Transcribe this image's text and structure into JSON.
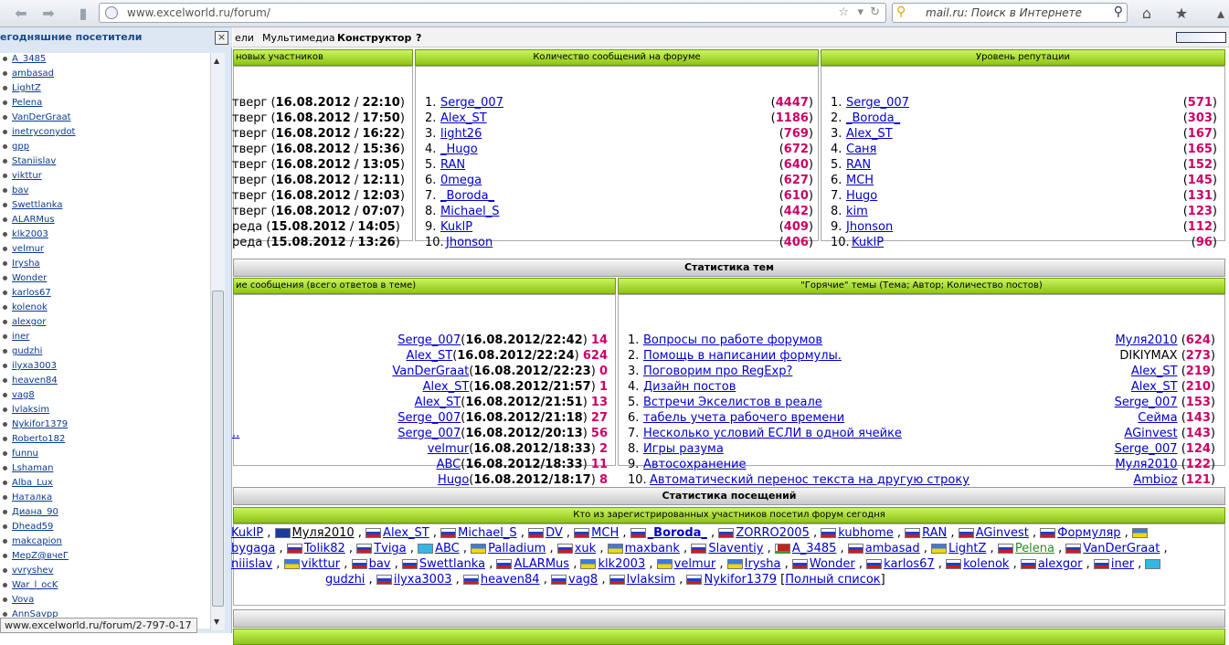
{
  "browser": {
    "url": "www.excelworld.ru/forum/",
    "search_placeholder": "mail.ru: Поиск в Интернете",
    "status": "www.excelworld.ru/forum/2-797-0-17"
  },
  "sidebar": {
    "title": "егодняшние посетители",
    "close": "×",
    "items": [
      "A_3485",
      "ambasad",
      "LightZ",
      "Pelena",
      "VanDerGraat",
      "inetryconydot",
      "gpp",
      "Staniislav",
      "vikttur",
      "bav",
      "Swettlanka",
      "ALARMus",
      "klk2003",
      "velmur",
      "Irysha",
      "Wonder",
      "karlos67",
      "kolenok",
      "alexgor",
      "iner",
      "gudzhi",
      "ilyxa3003",
      "heaven84",
      "vag8",
      "lvlaksim",
      "Nykifor1379",
      "Roberto182",
      "funnu",
      "Lshaman",
      "Alba_Lux",
      "Наталка",
      "Диана_90",
      "Dhead59",
      "makcapion",
      "МерZ@вчеГ",
      "vvryshev",
      "War_l_ocK",
      "Vova",
      "AnnSavpp"
    ]
  },
  "nav": {
    "item1": "ели",
    "item2": "Мультимедиа",
    "item3": "Конструктор",
    "item4": "?"
  },
  "top": {
    "new_header": "новых участников",
    "new_rows": [
      {
        "day": "тверг",
        "d": "16.08.2012",
        "t": "22:10"
      },
      {
        "day": "тверг",
        "d": "16.08.2012",
        "t": "17:50"
      },
      {
        "day": "тверг",
        "d": "16.08.2012",
        "t": "16:22"
      },
      {
        "day": "тверг",
        "d": "16.08.2012",
        "t": "15:36"
      },
      {
        "day": "тверг",
        "d": "16.08.2012",
        "t": "13:05"
      },
      {
        "day": "тверг",
        "d": "16.08.2012",
        "t": "12:11"
      },
      {
        "day": "тверг",
        "d": "16.08.2012",
        "t": "12:03"
      },
      {
        "day": "тверг",
        "d": "16.08.2012",
        "t": "07:07"
      },
      {
        "day": "реда",
        "d": "15.08.2012",
        "t": "14:05"
      },
      {
        "day": "реда",
        "d": "15.08.2012",
        "t": "13:26"
      }
    ],
    "posts_header": "Количество сообщений на форуме",
    "posts": [
      {
        "n": "1.",
        "name": "Serge_007",
        "v": "4447"
      },
      {
        "n": "2.",
        "name": "Alex_ST",
        "v": "1186"
      },
      {
        "n": "3.",
        "name": "light26",
        "v": "769"
      },
      {
        "n": "4.",
        "name": "_Hugo",
        "v": "672"
      },
      {
        "n": "5.",
        "name": "RAN",
        "v": "640"
      },
      {
        "n": "6.",
        "name": "0mega",
        "v": "627"
      },
      {
        "n": "7.",
        "name": "_Boroda_",
        "v": "610"
      },
      {
        "n": "8.",
        "name": "Michael_S",
        "v": "442"
      },
      {
        "n": "9.",
        "name": "KuklP",
        "v": "409"
      },
      {
        "n": "10.",
        "name": "Jhonson",
        "v": "406"
      }
    ],
    "rep_header": "Уровень репутации",
    "rep": [
      {
        "n": "1.",
        "name": "Serge_007",
        "v": "571"
      },
      {
        "n": "2.",
        "name": "_Boroda_",
        "v": "303"
      },
      {
        "n": "3.",
        "name": "Alex_ST",
        "v": "167"
      },
      {
        "n": "4.",
        "name": "Саня",
        "v": "165"
      },
      {
        "n": "5.",
        "name": "RAN",
        "v": "152"
      },
      {
        "n": "6.",
        "name": "MCH",
        "v": "145"
      },
      {
        "n": "7.",
        "name": "Hugo",
        "v": "131"
      },
      {
        "n": "8.",
        "name": "kim",
        "v": "123"
      },
      {
        "n": "9.",
        "name": "Jhonson",
        "v": "112"
      },
      {
        "n": "10.",
        "name": "KuklP",
        "v": "96"
      }
    ]
  },
  "topics": {
    "title": "Статистика тем",
    "last_header": "ие сообщения (всего ответов в теме)",
    "last": [
      {
        "name": "Serge_007",
        "dt": "16.08.2012/22:42",
        "c": "14"
      },
      {
        "name": "Alex_ST",
        "dt": "16.08.2012/22:24",
        "c": "624"
      },
      {
        "name": "VanDerGraat",
        "dt": "16.08.2012/22:23",
        "c": "0"
      },
      {
        "name": "Alex_ST",
        "dt": "16.08.2012/21:57",
        "c": "1"
      },
      {
        "name": "Alex_ST",
        "dt": "16.08.2012/21:51",
        "c": "13"
      },
      {
        "name": "Serge_007",
        "dt": "16.08.2012/21:18",
        "c": "27"
      },
      {
        "name": "Serge_007",
        "dt": "16.08.2012/20:13",
        "c": "56"
      },
      {
        "name": "velmur",
        "dt": "16.08.2012/18:33",
        "c": "2"
      },
      {
        "name": "ABC",
        "dt": "16.08.2012/18:33",
        "c": "11"
      },
      {
        "name": "Hugo",
        "dt": "16.08.2012/18:17",
        "c": "8"
      }
    ],
    "last_stubs": [
      "",
      "",
      "",
      "",
      "",
      "",
      "..",
      "",
      "",
      ""
    ],
    "hot_header": "\"Горячие\" темы (Тема; Автор; Количество постов)",
    "hot": [
      {
        "n": "1.",
        "title": "Вопросы по работе форумов",
        "author": "Муля2010",
        "c": "624"
      },
      {
        "n": "2.",
        "title": "Помощь в написании формулы.",
        "author": "DIKIYMAX",
        "c": "273"
      },
      {
        "n": "3.",
        "title": "Поговорим про RegExp?",
        "author": "Alex_ST",
        "c": "219"
      },
      {
        "n": "4.",
        "title": "Дизайн постов",
        "author": "Alex_ST",
        "c": "210"
      },
      {
        "n": "5.",
        "title": "Встречи Экселистов в реале",
        "author": "Serge_007",
        "c": "153"
      },
      {
        "n": "6.",
        "title": "табель учета рабочего времени",
        "author": "Сейма",
        "c": "143"
      },
      {
        "n": "7.",
        "title": "Несколько условий ЕСЛИ в одной ячейке",
        "author": "AGinvest",
        "c": "143"
      },
      {
        "n": "8.",
        "title": "Игры разума",
        "author": "Serge_007",
        "c": "124"
      },
      {
        "n": "9.",
        "title": "Автосохранение",
        "author": "Муля2010",
        "c": "122"
      },
      {
        "n": "10.",
        "title": "Автоматический перенос текста на другую строку",
        "author": "Ambioz",
        "c": "121"
      }
    ]
  },
  "visits": {
    "title": "Статистика посещений",
    "header": "Кто из зарегистрированных участников посетил форум сегодня",
    "line1": [
      {
        "f": "",
        "n": "KuklP"
      },
      {
        "f": "eu",
        "n": "Муля2010"
      },
      {
        "f": "ru",
        "n": "Alex_ST"
      },
      {
        "f": "ru",
        "n": "Michael_S"
      },
      {
        "f": "ru",
        "n": "DV"
      },
      {
        "f": "ru",
        "n": "MCH"
      },
      {
        "f": "ru",
        "n": "_Boroda_"
      },
      {
        "f": "ru",
        "n": "ZORRO2005"
      },
      {
        "f": "ru",
        "n": "kubhome"
      },
      {
        "f": "ru",
        "n": "RAN"
      },
      {
        "f": "ru",
        "n": "AGinvest"
      },
      {
        "f": "ru",
        "n": "Формуляр"
      },
      {
        "f": "ua",
        "n": ""
      }
    ],
    "line2": [
      {
        "f": "",
        "n": "bygaga"
      },
      {
        "f": "ru",
        "n": "Tolik82"
      },
      {
        "f": "ru",
        "n": "Tviga"
      },
      {
        "f": "kz",
        "n": "ABC"
      },
      {
        "f": "ua",
        "n": "Palladium"
      },
      {
        "f": "ru",
        "n": "xuk"
      },
      {
        "f": "ua",
        "n": "maxbank"
      },
      {
        "f": "ru",
        "n": "Slaventiy"
      },
      {
        "f": "by",
        "n": "A_3485"
      },
      {
        "f": "ru",
        "n": "ambasad"
      },
      {
        "f": "ua",
        "n": "LightZ"
      },
      {
        "f": "ru",
        "n": "Pelena"
      },
      {
        "f": "ru",
        "n": "VanDerGraat"
      }
    ],
    "line3": [
      {
        "f": "",
        "n": "niiislav"
      },
      {
        "f": "ua",
        "n": "vikttur"
      },
      {
        "f": "ru",
        "n": "bav"
      },
      {
        "f": "ru",
        "n": "Swettlanka"
      },
      {
        "f": "ru",
        "n": "ALARMus"
      },
      {
        "f": "ua",
        "n": "klk2003"
      },
      {
        "f": "ua",
        "n": "velmur"
      },
      {
        "f": "ua",
        "n": "Irysha"
      },
      {
        "f": "ru",
        "n": "Wonder"
      },
      {
        "f": "ru",
        "n": "karlos67"
      },
      {
        "f": "ru",
        "n": "kolenok"
      },
      {
        "f": "ru",
        "n": "alexgor"
      },
      {
        "f": "ru",
        "n": "iner"
      },
      {
        "f": "kz",
        "n": ""
      }
    ],
    "line4": [
      {
        "f": "",
        "n": "gudzhi"
      },
      {
        "f": "ru",
        "n": "ilyxa3003"
      },
      {
        "f": "ru",
        "n": "heaven84"
      },
      {
        "f": "ru",
        "n": "vag8"
      },
      {
        "f": "ru",
        "n": "lvlaksim"
      },
      {
        "f": "ru",
        "n": "Nykifor1379"
      }
    ],
    "full": "Полный список"
  }
}
